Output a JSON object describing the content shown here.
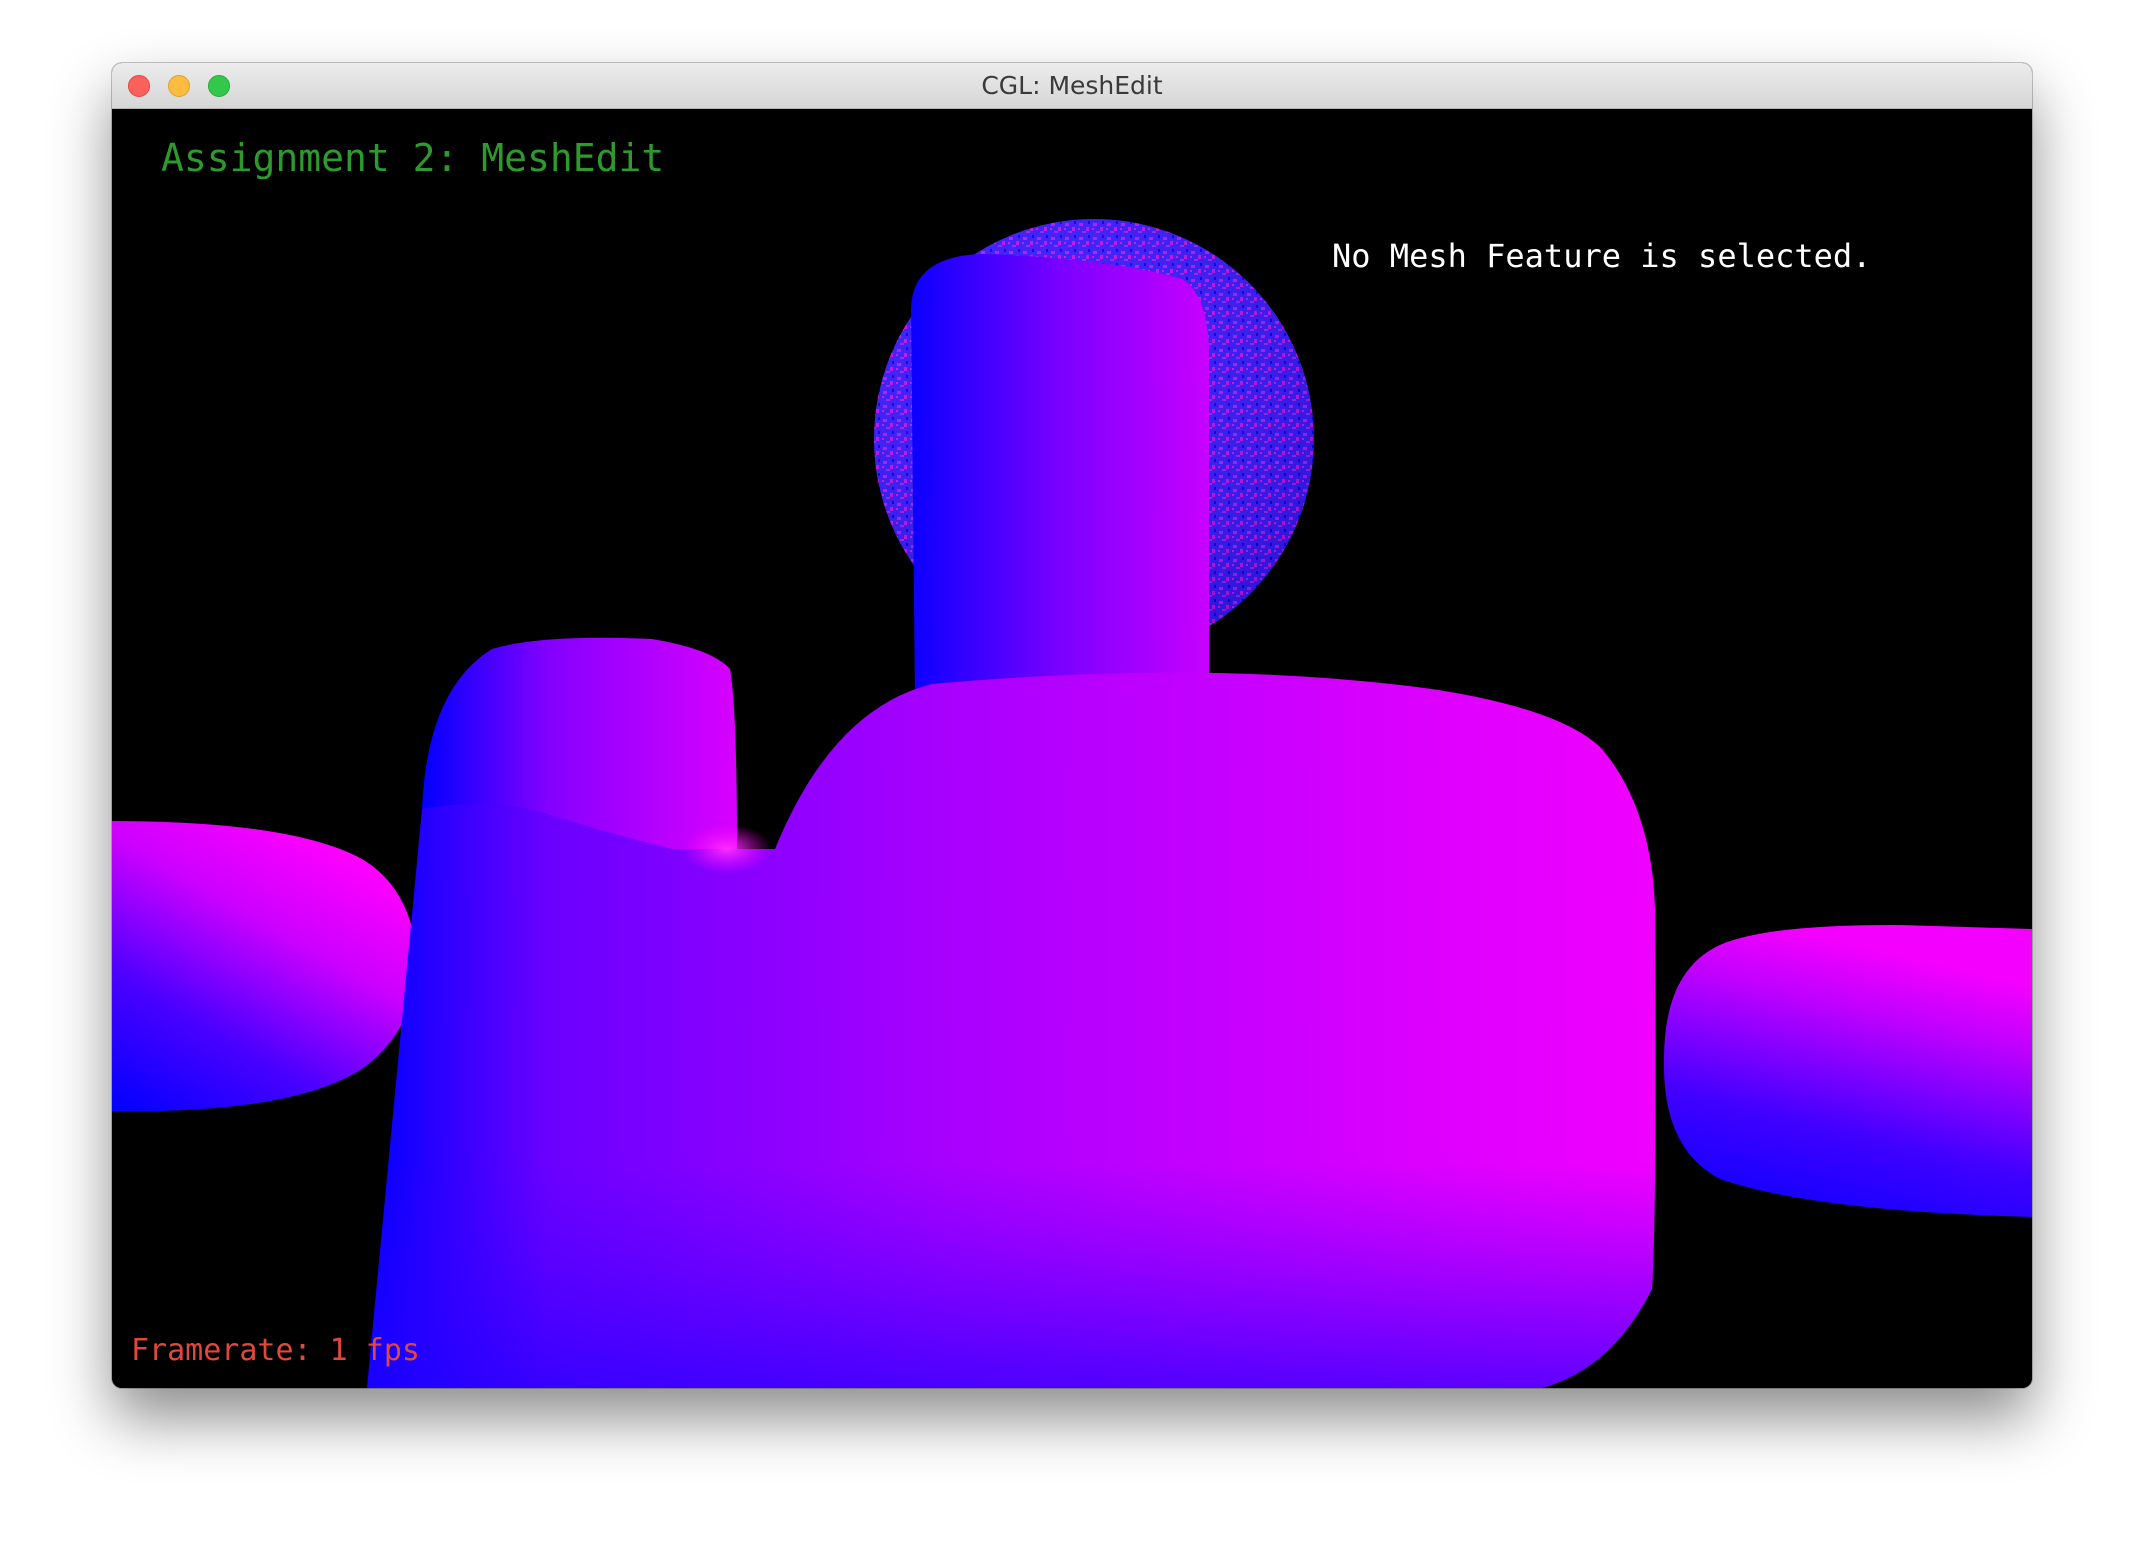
{
  "window": {
    "title": "CGL: MeshEdit"
  },
  "hud": {
    "title": "Assignment 2: MeshEdit",
    "selection_status": "No Mesh Feature is selected.",
    "framerate": "Framerate: 1 fps"
  },
  "colors": {
    "background": "#000000",
    "mesh_blue": "#0000ff",
    "mesh_magenta": "#ff00ff",
    "mesh_violet": "#8a00ff",
    "hud_title": "#2e9a2e",
    "hud_selection": "#ffffff",
    "hud_fps": "#e0483c"
  }
}
